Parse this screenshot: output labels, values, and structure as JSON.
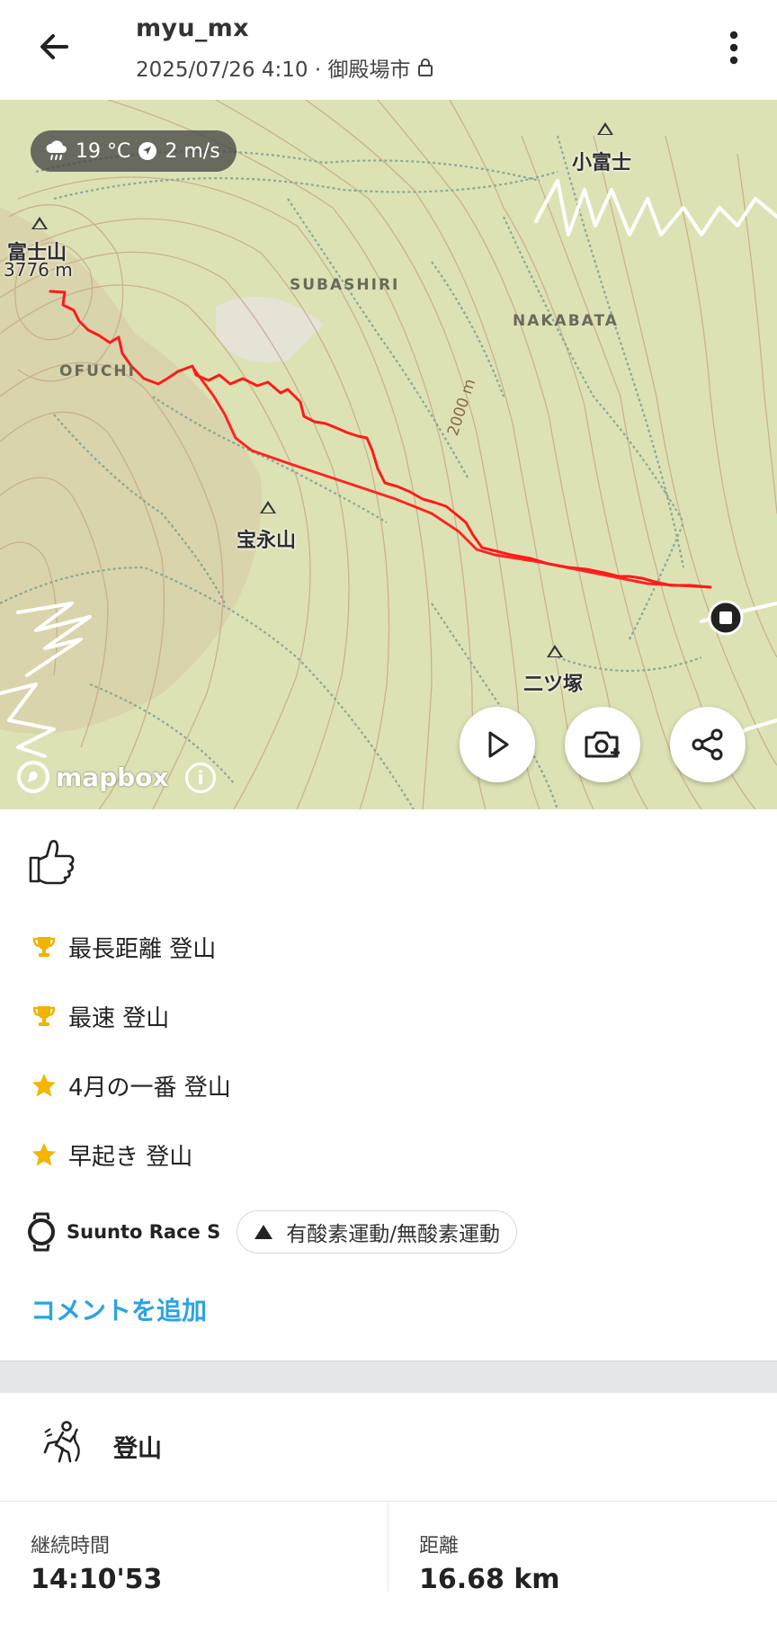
{
  "header": {
    "username": "myu_mx",
    "subtitle": "2025/07/26 4:10 · 御殿場市",
    "back_icon": "arrow-left-icon",
    "lock_icon": "lock-icon",
    "more_icon": "more-vertical-icon"
  },
  "map": {
    "weather": {
      "icon": "cloud-rain-icon",
      "temperature": "19 °C",
      "wind_icon": "navigation-arrow-icon",
      "wind": "2 m/s"
    },
    "peaks": [
      {
        "name": "富士山",
        "elevation": "3776 m"
      },
      {
        "name": "小富士"
      },
      {
        "name": "宝永山"
      },
      {
        "name": "二ツ塚"
      }
    ],
    "areas": [
      "SUBASHIRI",
      "NAKABATA",
      "OFUCHI"
    ],
    "contour_label": "2000 m",
    "attribution": "mapbox",
    "route_color": "#ff1a1a",
    "buttons": [
      "play-icon",
      "camera-add-icon",
      "share-icon"
    ]
  },
  "achievements": [
    {
      "icon": "trophy-icon",
      "text": "最長距離 登山"
    },
    {
      "icon": "trophy-icon",
      "text": "最速 登山"
    },
    {
      "icon": "star-icon",
      "text": "4月の一番 登山"
    },
    {
      "icon": "star-icon",
      "text": "早起き 登山"
    }
  ],
  "device": {
    "icon": "watch-icon",
    "name": "Suunto Race S"
  },
  "training_tag": {
    "icon": "triangle-icon",
    "label": "有酸素運動/無酸素運動"
  },
  "add_comment": "コメントを追加",
  "activity": {
    "icon": "hiking-icon",
    "title": "登山",
    "stats": [
      {
        "label": "継続時間",
        "value": "14:10'53"
      },
      {
        "label": "距離",
        "value": "16.68 km"
      }
    ]
  },
  "colors": {
    "accent": "#2ba3e4",
    "trophy": "#f2b200",
    "star": "#f5b400"
  }
}
